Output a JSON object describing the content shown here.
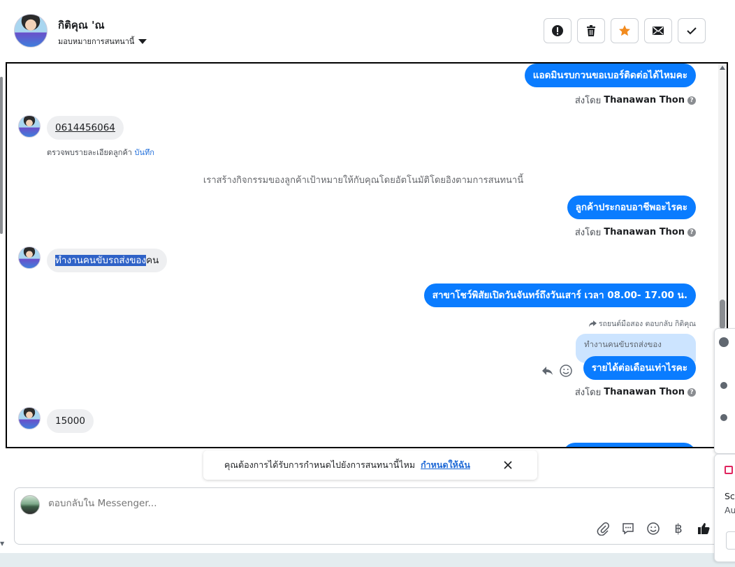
{
  "header": {
    "contact_name": "กิติคุณ 'ณ",
    "assign_label": "มอบหมายการสนทนานี้",
    "actions": [
      "report",
      "delete",
      "star",
      "mark-unread",
      "done"
    ]
  },
  "conversation": {
    "messages": [
      {
        "dir": "out",
        "text": "แอดมินรบกวนขอเบอร์ติดต่อได้ไหมคะ",
        "sent_by_prefix": "ส่งโดย",
        "sender": "Thanawan Thon"
      },
      {
        "dir": "in",
        "text": "0614456064",
        "note_text": "ตรวจพบรายละเอียดลูกค้า",
        "note_link": "บันทึก"
      },
      {
        "dir": "system",
        "text": "เราสร้างกิจกรรมของลูกค้าเป้าหมายให้กับคุณโดยอัตโนมัติโดยอิงตามการสนทนานี้"
      },
      {
        "dir": "out",
        "text": "ลูกค้าประกอบอาชีพอะไรคะ",
        "sent_by_prefix": "ส่งโดย",
        "sender": "Thanawan Thon"
      },
      {
        "dir": "in",
        "text_selected": "ทำงานคนขับรถส่งของ",
        "text_rest": "คน"
      },
      {
        "dir": "out",
        "text": "สาขาโชว์พิสัยเปิดวันจันทร์ถึงวันเสาร์ เวลา 08.00- 17.00 น."
      },
      {
        "dir": "out",
        "reply_label": "รถยนต์มือสอง ตอบกลับ กิติคุณ",
        "quoted": "ทำงานคนขับรถส่งของ",
        "text": "รายได้ต่อเดือนเท่าไรคะ",
        "sent_by_prefix": "ส่งโดย",
        "sender": "Thanawan Thon"
      },
      {
        "dir": "in",
        "text": "15000"
      }
    ]
  },
  "toast": {
    "text": "คุณต้องการได้รับการกำหนดไปยังการสนทนานี้ไหม",
    "link": "กำหนดให้ฉัน"
  },
  "composer": {
    "placeholder": "ตอบกลับใน Messenger..."
  },
  "side_popup": {
    "line1": "Sc",
    "line2": "Au"
  },
  "colors": {
    "accent": "#0a7cff",
    "link": "#1d68d6",
    "star": "#f28b1e",
    "selection": "#2f62c7"
  }
}
